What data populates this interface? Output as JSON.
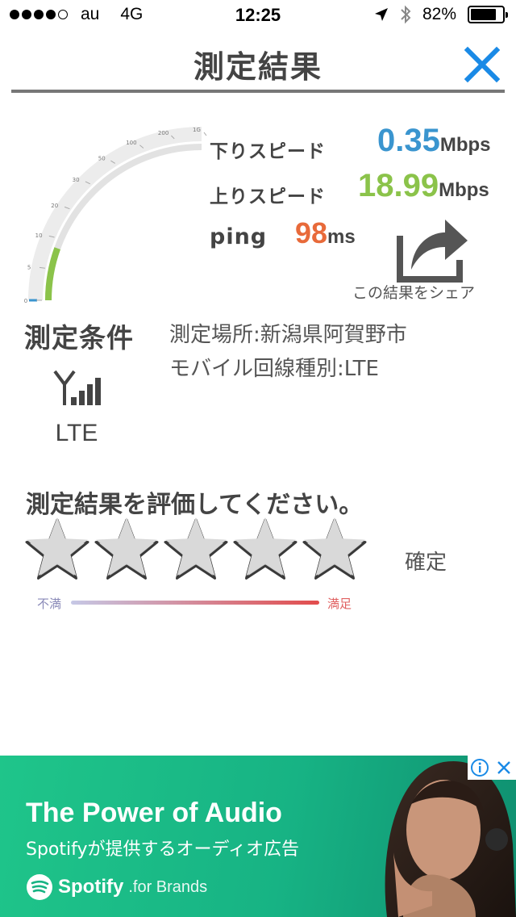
{
  "status_bar": {
    "carrier": "au",
    "network": "4G",
    "time": "12:25",
    "battery": "82%",
    "battery_level": 0.82,
    "signal_dots_filled": 4
  },
  "header": {
    "title": "測定結果"
  },
  "gauge": {
    "tick_labels": [
      "0",
      "5",
      "10",
      "20",
      "30",
      "50",
      "100",
      "200",
      "1G"
    ],
    "level_fraction": 0.22,
    "fill_color": "#8bc34a"
  },
  "results": {
    "download": {
      "label": "下りスピード",
      "value": "0.35",
      "unit": "Mbps",
      "color": "#3a95cf"
    },
    "upload": {
      "label": "上りスピード",
      "value": "18.99",
      "unit": "Mbps",
      "color": "#8bc34a"
    },
    "ping": {
      "label": "ping",
      "value": "98",
      "unit": "ms",
      "color": "#e86a3a"
    }
  },
  "share": {
    "label": "この結果をシェア"
  },
  "conditions": {
    "heading": "測定条件",
    "location": "測定場所:新潟県阿賀野市",
    "line_type": "モバイル回線種別:LTE",
    "network_label": "LTE"
  },
  "rating": {
    "prompt": "測定結果を評価してください。",
    "stars": 5,
    "confirm_label": "確定",
    "scale_low": "不満",
    "scale_high": "満足"
  },
  "ad": {
    "headline": "The Power of Audio",
    "subline": "Spotifyが提供するオーディオ広告",
    "brand": "Spotify",
    "brand_suffix": ".for Brands"
  }
}
